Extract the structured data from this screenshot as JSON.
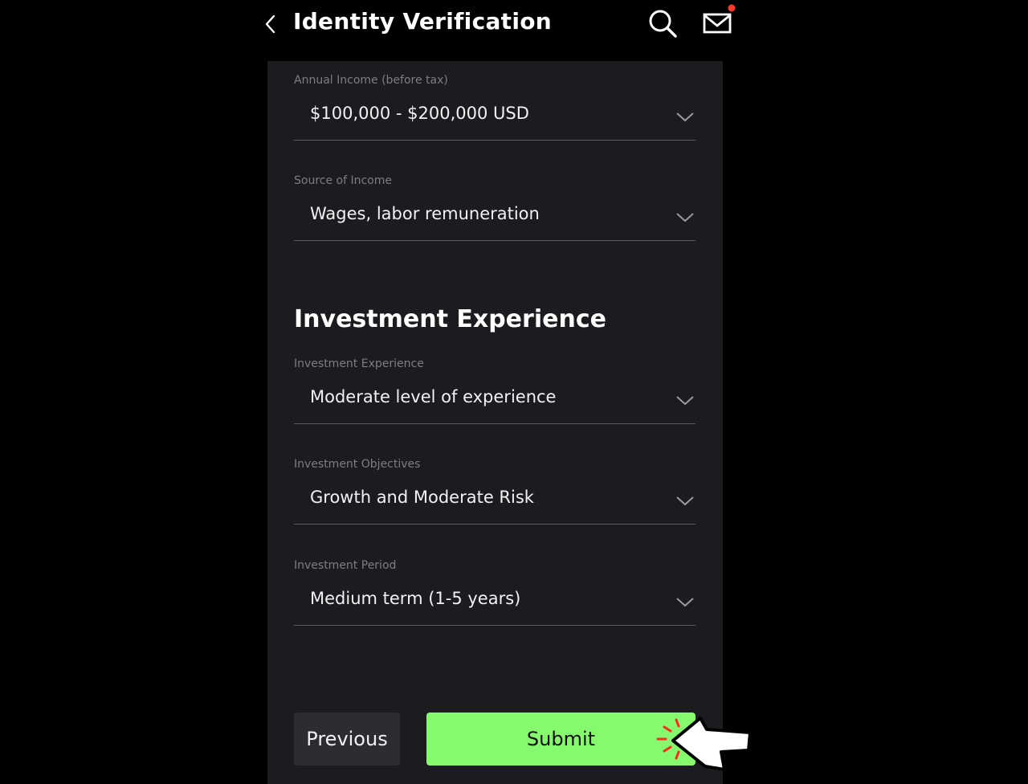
{
  "header": {
    "title": "Identity Verification",
    "back_icon": "chevron-left-icon",
    "search_icon": "search-icon",
    "mail_icon": "mail-icon",
    "mail_has_notification": true,
    "notification_color": "#ff3b30"
  },
  "fields": {
    "annual_income": {
      "label": "Annual Income (before tax)",
      "value": "$100,000 - $200,000 USD"
    },
    "source_of_income": {
      "label": "Source of Income",
      "value": "Wages, labor remuneration"
    },
    "investment_experience": {
      "label": "Investment Experience",
      "value": "Moderate level of experience"
    },
    "investment_objectives": {
      "label": "Investment Objectives",
      "value": "Growth and Moderate Risk"
    },
    "investment_period": {
      "label": "Investment Period",
      "value": "Medium term (1-5 years)"
    }
  },
  "section": {
    "title": "Investment Experience"
  },
  "actions": {
    "previous_label": "Previous",
    "submit_label": "Submit"
  },
  "colors": {
    "background": "#000000",
    "panel": "#1b1b20",
    "accent": "#86f96f",
    "secondary_button": "#2c2c33",
    "label_text": "#7d7d86"
  },
  "overlay": {
    "cursor_icon": "pointer-hand-cursor-icon",
    "click_burst_icon": "click-burst-icon",
    "click_color": "#ff2a1a"
  }
}
